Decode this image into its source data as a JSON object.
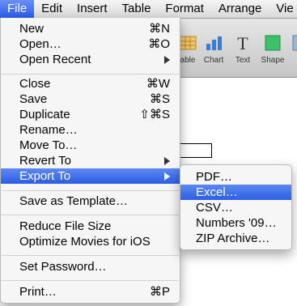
{
  "menubar": {
    "items": [
      "File",
      "Edit",
      "Insert",
      "Table",
      "Format",
      "Arrange",
      "Vie"
    ]
  },
  "toolbar": {
    "items": [
      {
        "label": "able",
        "icon": "table-icon"
      },
      {
        "label": "Chart",
        "icon": "chart-icon"
      },
      {
        "label": "Text",
        "icon": "text-icon"
      },
      {
        "label": "Shape",
        "icon": "shape-icon"
      },
      {
        "label": "M",
        "icon": "media-icon"
      }
    ]
  },
  "file_menu": {
    "new": {
      "label": "New",
      "shortcut": "⌘N"
    },
    "open": {
      "label": "Open…",
      "shortcut": "⌘O"
    },
    "open_recent": {
      "label": "Open Recent"
    },
    "close": {
      "label": "Close",
      "shortcut": "⌘W"
    },
    "save": {
      "label": "Save",
      "shortcut": "⌘S"
    },
    "duplicate": {
      "label": "Duplicate",
      "shortcut": "⇧⌘S"
    },
    "rename": {
      "label": "Rename…"
    },
    "move_to": {
      "label": "Move To…"
    },
    "revert_to": {
      "label": "Revert To"
    },
    "export_to": {
      "label": "Export To"
    },
    "save_as_template": {
      "label": "Save as Template…"
    },
    "reduce_file_size": {
      "label": "Reduce File Size"
    },
    "optimize_movies": {
      "label": "Optimize Movies for iOS"
    },
    "set_password": {
      "label": "Set Password…"
    },
    "print": {
      "label": "Print…",
      "shortcut": "⌘P"
    }
  },
  "export_submenu": {
    "items": [
      "PDF…",
      "Excel…",
      "CSV…",
      "Numbers '09…",
      "ZIP Archive…"
    ],
    "selected": "Excel…"
  },
  "colors": {
    "highlight": "#2b5fe3",
    "menubar_bg": "#e6e6e6"
  }
}
